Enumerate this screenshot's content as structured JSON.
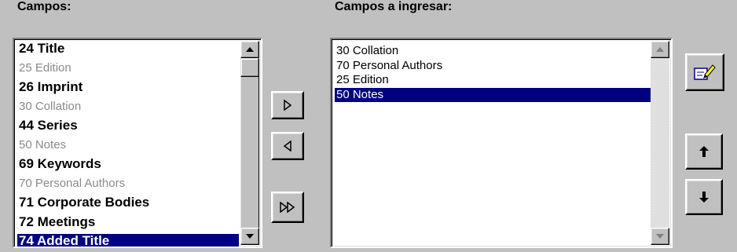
{
  "left_panel": {
    "label": "Campos:",
    "items": [
      {
        "text": "24 Title",
        "style": "bold"
      },
      {
        "text": "25 Edition",
        "style": "dim"
      },
      {
        "text": "26 Imprint",
        "style": "bold"
      },
      {
        "text": "30 Collation",
        "style": "dim"
      },
      {
        "text": "44 Series",
        "style": "bold"
      },
      {
        "text": "50 Notes",
        "style": "dim"
      },
      {
        "text": "69 Keywords",
        "style": "bold"
      },
      {
        "text": "70 Personal Authors",
        "style": "dim"
      },
      {
        "text": "71 Corporate Bodies",
        "style": "bold"
      },
      {
        "text": "72 Meetings",
        "style": "bold"
      },
      {
        "text": "74 Added Title",
        "style": "bold-selected"
      }
    ]
  },
  "right_panel": {
    "label": "Campos a ingresar:",
    "items": [
      {
        "text": "30 Collation",
        "style": "normal"
      },
      {
        "text": "70 Personal Authors",
        "style": "normal"
      },
      {
        "text": "25 Edition",
        "style": "normal"
      },
      {
        "text": "50 Notes",
        "style": "selected"
      }
    ]
  },
  "buttons": {
    "add": "add-arrow-icon",
    "remove": "remove-arrow-icon",
    "add_all": "add-all-arrow-icon",
    "edit": "edit-pencil-icon",
    "move_up": "up-arrow-icon",
    "move_down": "down-arrow-icon"
  },
  "colors": {
    "selection": "#000080",
    "dim_text": "#8a8a8a",
    "face": "#c0c0c0"
  }
}
